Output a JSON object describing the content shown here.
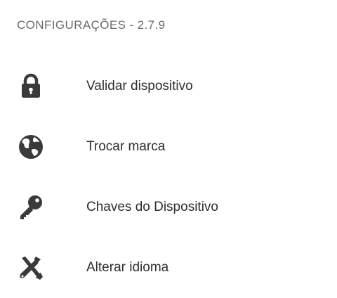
{
  "settings": {
    "title": "CONFIGURAÇÕES - 2.7.9",
    "icon_color": "#3a3a3a",
    "items": [
      {
        "label": "Validar dispositivo",
        "icon": "lock-icon"
      },
      {
        "label": "Trocar marca",
        "icon": "globe-icon"
      },
      {
        "label": "Chaves do Dispositivo",
        "icon": "key-icon"
      },
      {
        "label": "Alterar idioma",
        "icon": "tools-icon"
      }
    ]
  }
}
